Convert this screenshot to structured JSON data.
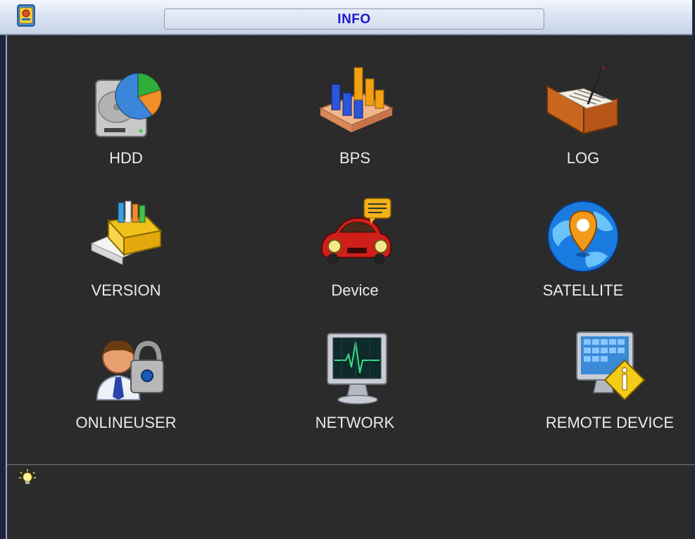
{
  "window": {
    "title": "INFO",
    "app_icon": "dvr-app-icon"
  },
  "menu": {
    "items": [
      {
        "label": "HDD",
        "icon": "hdd-pie-chart-icon"
      },
      {
        "label": "BPS",
        "icon": "bps-bar-chart-icon"
      },
      {
        "label": "LOG",
        "icon": "log-book-quill-icon"
      },
      {
        "label": "VERSION",
        "icon": "version-file-box-icon"
      },
      {
        "label": "Device",
        "icon": "device-car-icon"
      },
      {
        "label": "SATELLITE",
        "icon": "satellite-globe-pin-icon"
      },
      {
        "label": "ONLINEUSER",
        "icon": "online-user-lock-icon"
      },
      {
        "label": "NETWORK",
        "icon": "network-monitor-icon"
      },
      {
        "label": "REMOTE DEVICE",
        "icon": "remote-device-warning-icon"
      }
    ]
  },
  "status": {
    "hint_icon": "lightbulb-icon",
    "hint_text": ""
  },
  "colors": {
    "background": "#2b2b2b",
    "label": "#ebebeb",
    "title_text": "#1a1ad0"
  }
}
